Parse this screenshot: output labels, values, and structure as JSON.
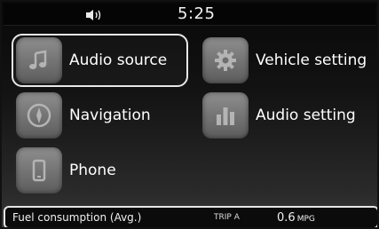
{
  "status": {
    "time": "5:25",
    "volume_icon": "speaker-icon"
  },
  "menu": [
    {
      "label": "Audio source",
      "icon": "music-note-icon",
      "selected": true
    },
    {
      "label": "Vehicle setting",
      "icon": "gear-icon"
    },
    {
      "label": "Navigation",
      "icon": "compass-icon"
    },
    {
      "label": "Audio setting",
      "icon": "equalizer-icon"
    },
    {
      "label": "Phone",
      "icon": "phone-icon"
    }
  ],
  "footer": {
    "label": "Fuel consumption (Avg.)",
    "trip": "TRIP A",
    "value": "0.6",
    "unit": "MPG"
  },
  "colors": {
    "screen_bg": "#141414",
    "tile": "#7a7a7a",
    "highlight": "#e8e8e8"
  }
}
